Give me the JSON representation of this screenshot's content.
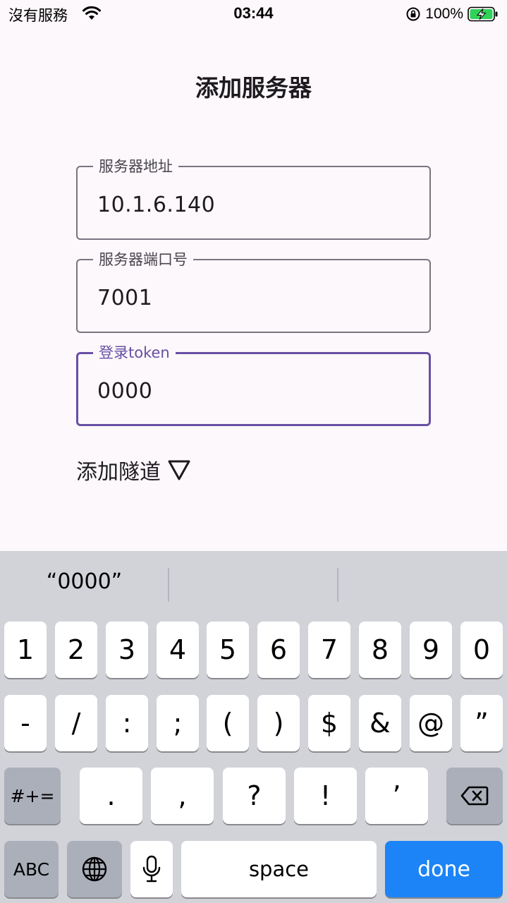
{
  "status_bar": {
    "carrier": "沒有服務",
    "time": "03:44",
    "battery_percent": "100%",
    "battery_level": 1.0,
    "charging": true
  },
  "page": {
    "title": "添加服务器"
  },
  "form": {
    "server_address": {
      "label": "服务器地址",
      "value": "10.1.6.140"
    },
    "server_port": {
      "label": "服务器端口号",
      "value": "7001"
    },
    "login_token": {
      "label": "登录token",
      "value": "0000",
      "focused": true
    },
    "add_tunnel": {
      "label": "添加隧道",
      "icon": "triangle-down-outline-icon"
    }
  },
  "keyboard": {
    "suggestions": [
      "“0000”",
      "",
      ""
    ],
    "row1": [
      "1",
      "2",
      "3",
      "4",
      "5",
      "6",
      "7",
      "8",
      "9",
      "0"
    ],
    "row2": [
      "-",
      "/",
      ":",
      ";",
      "(",
      ")",
      "$",
      "&",
      "@",
      "”"
    ],
    "row3": {
      "mode_key": "#+=",
      "keys": [
        ".",
        ",",
        "?",
        "!",
        "’"
      ],
      "delete_icon": "backspace-icon"
    },
    "row4": {
      "abc_key": "ABC",
      "globe_icon": "globe-icon",
      "mic_icon": "microphone-icon",
      "space_key": "space",
      "done_key": "done"
    }
  },
  "colors": {
    "accent": "#6750a4",
    "outline": "#79747e",
    "background": "#fdf8fb",
    "keyboard_bg": "#d1d3d9",
    "done_key": "#1c84f6",
    "battery": "#30d158"
  }
}
